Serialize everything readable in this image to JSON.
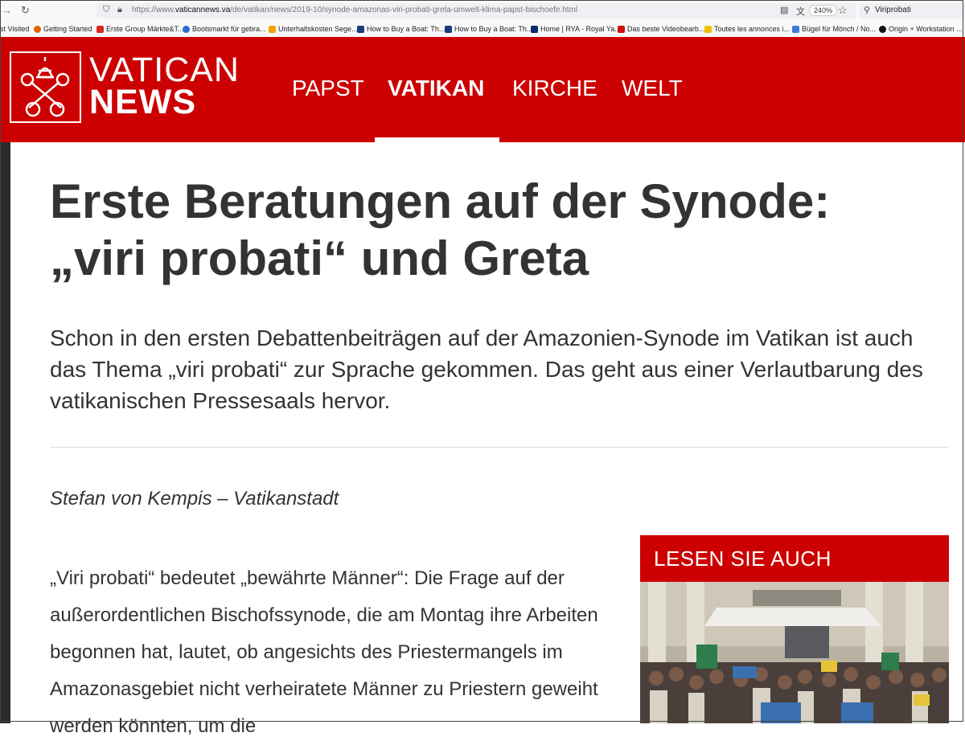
{
  "browser": {
    "url_prefix": "https://www.",
    "url_domain": "vaticannews.va",
    "url_path": "/de/vatikan/news/2019-10/synode-amazonas-viri-probati-greta-umwelt-klima-papst-bischoefe.html",
    "zoom": "240%",
    "search_value": "Viriprobati"
  },
  "bookmarks": [
    {
      "label": "st Visited",
      "color": "#777777"
    },
    {
      "label": "Getting Started",
      "color": "#e66000"
    },
    {
      "label": "Erste Group Märkte&T...",
      "color": "#d22"
    },
    {
      "label": "Bootsmarkt für gebra...",
      "color": "#2a6bd8"
    },
    {
      "label": "Unterhaltskosten Sege...",
      "color": "#f5a300"
    },
    {
      "label": "How to Buy a Boat: Th...",
      "color": "#1a3b7a"
    },
    {
      "label": "How to Buy a Boat: Th...",
      "color": "#1a3b7a"
    },
    {
      "label": "Home | RYA - Royal Ya...",
      "color": "#0b2a6b"
    },
    {
      "label": "Das beste Videobearb...",
      "color": "#cc1111"
    },
    {
      "label": "Toutes les annonces i...",
      "color": "#f0c000"
    },
    {
      "label": "Bügel für Mönch / No...",
      "color": "#3a7bd5"
    },
    {
      "label": "Origin + Workstation ...",
      "color": "#111111"
    }
  ],
  "site": {
    "logo_top": "VATICAN",
    "logo_bottom": "NEWS",
    "brand_color": "#cc0000",
    "nav": [
      "PAPST",
      "VATIKAN",
      "KIRCHE",
      "WELT"
    ],
    "active_nav": "VATIKAN"
  },
  "article": {
    "headline_line1": "Erste Beratungen auf der Synode:",
    "headline_line2": "„viri probati“ und Greta",
    "lead": "Schon in den ersten Debattenbeiträgen auf der Amazonien-Synode im Vatikan ist auch das Thema „viri probati“ zur Sprache gekommen. Das geht aus einer Verlautbarung des vatikanischen Pressesaals hervor.",
    "author": "Stefan von Kempis – Vatikanstadt",
    "body": "„Viri probati“ bedeutet „bewährte Männer“: Die Frage auf der außerordentlichen Bischofssynode, die am Montag ihre Arbeiten begonnen hat, lautet, ob angesichts des Priestermangels im Amazonasgebiet nicht verheiratete Männer zu Priestern geweiht werden könnten, um die"
  },
  "sidebar": {
    "title": "LESEN SIE AUCH"
  }
}
